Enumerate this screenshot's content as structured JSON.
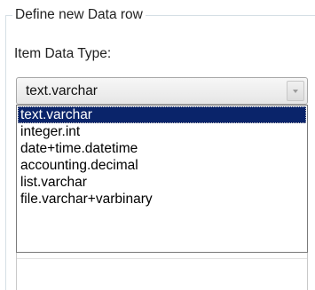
{
  "group": {
    "legend": "Define new Data row"
  },
  "item_data_type": {
    "label": "Item Data Type:",
    "selected_value": "text.varchar",
    "dropdown_icon": "chevron-down-icon",
    "options": [
      "text.varchar",
      "integer.int",
      "date+time.datetime",
      "accounting.decimal",
      "list.varchar",
      "file.varchar+varbinary"
    ],
    "highlighted_index": 0
  },
  "colors": {
    "selection_background": "#0a246a",
    "selection_text": "#ffffff",
    "group_border": "#d5dfe5"
  }
}
